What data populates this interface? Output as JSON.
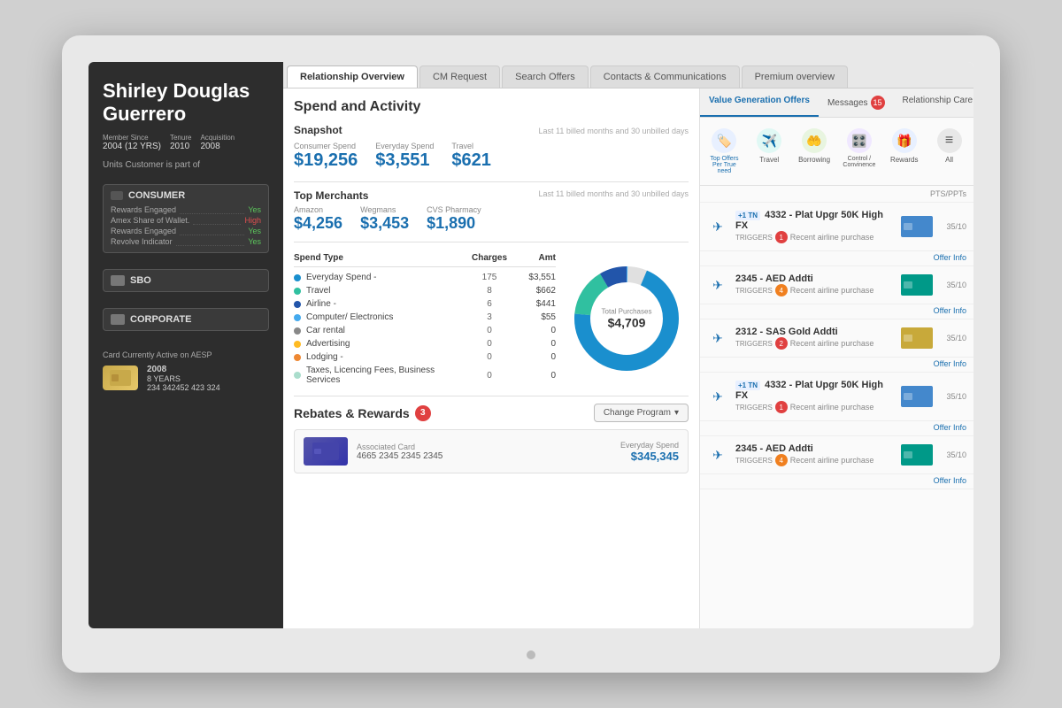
{
  "laptop": {
    "screen_bg": "#f0f0f0"
  },
  "customer": {
    "name": "Shirley Douglas Guerrero",
    "member_since_label": "Member Since",
    "member_since": "2004 (12 YRS)",
    "tenure_label": "Tenure",
    "tenure": "2010",
    "acquisition_label": "Acquisition",
    "acquisition": "2008",
    "units_label": "Units Customer is part of"
  },
  "consumer_unit": {
    "title": "CONSUMER",
    "rows": [
      {
        "label": "Rewards Engaged",
        "value": "Yes",
        "type": "yes"
      },
      {
        "label": "Amex Share of Wallet.",
        "value": "High",
        "type": "high"
      },
      {
        "label": "Rewards Engaged",
        "value": "Yes",
        "type": "yes"
      },
      {
        "label": "Revolve Indicator",
        "value": "Yes",
        "type": "yes"
      }
    ]
  },
  "sbo_unit": {
    "title": "SBO"
  },
  "corporate_unit": {
    "title": "CORPORATE"
  },
  "aesp": {
    "label": "Card Currently Active on AESP",
    "year": "2008",
    "tenure": "8 YEARS",
    "number": "234 342452 423 324"
  },
  "tabs": [
    {
      "label": "Relationship Overview",
      "active": true
    },
    {
      "label": "CM Request",
      "active": false
    },
    {
      "label": "Search Offers",
      "active": false
    },
    {
      "label": "Contacts & Communications",
      "active": false
    },
    {
      "label": "Premium overview",
      "active": false
    }
  ],
  "spend": {
    "section_title": "Spend and Activity",
    "snapshot_label": "Snapshot",
    "snapshot_period": "Last 11 billed months and 30 unbilled days",
    "consumer_spend_label": "Consumer Spend",
    "consumer_spend": "$19,256",
    "everyday_spend_label": "Everyday Spend",
    "everyday_spend": "$3,551",
    "travel_label": "Travel",
    "travel": "$621",
    "merchants_label": "Top Merchants",
    "merchants_period": "Last 11 billed months and 30 unbilled days",
    "amazon_label": "Amazon",
    "amazon": "$4,256",
    "wegmans_label": "Wegmans",
    "wegmans": "$3,453",
    "cvs_label": "CVS Pharmacy",
    "cvs": "$1,890",
    "spend_type_header": "Spend Type",
    "charges_header": "Charges",
    "amt_header": "Amt",
    "spend_rows": [
      {
        "color": "#1a8fce",
        "name": "Everyday Spend -",
        "charges": "175",
        "amt": "$3,551"
      },
      {
        "color": "#30c0a0",
        "name": "Travel",
        "charges": "8",
        "amt": "$662"
      },
      {
        "color": "#2255aa",
        "name": "Airline -",
        "charges": "6",
        "amt": "$441"
      },
      {
        "color": "#44aaee",
        "name": "Computer/ Electronics",
        "charges": "3",
        "amt": "$55"
      },
      {
        "color": "#888888",
        "name": "Car rental",
        "charges": "0",
        "amt": "0"
      },
      {
        "color": "#ffbb22",
        "name": "Advertising",
        "charges": "0",
        "amt": "0"
      },
      {
        "color": "#ee8833",
        "name": "Lodging -",
        "charges": "0",
        "amt": "0"
      },
      {
        "color": "#aaddcc",
        "name": "Taxes, Licencing Fees, Business Services",
        "charges": "0",
        "amt": "0"
      }
    ],
    "donut_label": "Total Purchases",
    "donut_value": "$4,709"
  },
  "rebates": {
    "title": "Rebates & Rewards",
    "count": "3",
    "change_program": "Change Program",
    "card_type": "Associated Card",
    "card_number": "4665 2345 2345 2345",
    "spend_label": "Everyday Spend",
    "spend_value": "$345,345"
  },
  "right_panel": {
    "tabs": [
      {
        "label": "Value Generation Offers",
        "active": true
      },
      {
        "label": "Messages",
        "active": false,
        "badge": "15"
      },
      {
        "label": "Relationship Care History",
        "active": false
      }
    ],
    "categories": [
      {
        "label": "Top Offers\nPer True need",
        "icon": "🏷️",
        "color": "blue",
        "active": true
      },
      {
        "label": "Travel",
        "icon": "✈️",
        "color": "teal"
      },
      {
        "label": "Borrowing",
        "icon": "🤲",
        "color": "green"
      },
      {
        "label": "Control /\nConvinence",
        "icon": "🎛️",
        "color": "purple"
      },
      {
        "label": "Rewards",
        "icon": "🎁",
        "color": "blue"
      },
      {
        "label": "All",
        "icon": "≡",
        "color": "gray"
      }
    ],
    "pts_header": "PTS/PPTs",
    "offers": [
      {
        "title": "4332 - Plat Upgr 50K High FX",
        "plus": "+1 TN",
        "trigger_num": "1",
        "trigger_color": "red",
        "trigger_text": "Recent airline purchase",
        "pts": "35/10",
        "thumb_color": "blue"
      },
      {
        "title": "2345 - AED Addti",
        "plus": null,
        "trigger_num": "4",
        "trigger_color": "orange",
        "trigger_text": "Recent airline purchase",
        "pts": "35/10",
        "thumb_color": "teal"
      },
      {
        "title": "2312 - SAS Gold Addti",
        "plus": null,
        "trigger_num": "2",
        "trigger_color": "red",
        "trigger_text": "Recent airline purchase",
        "pts": "35/10",
        "thumb_color": "gold"
      },
      {
        "title": "4332 - Plat Upgr 50K High FX",
        "plus": "+1 TN",
        "trigger_num": "1",
        "trigger_color": "red",
        "trigger_text": "Recent airline purchase",
        "pts": "35/10",
        "thumb_color": "blue"
      },
      {
        "title": "2345 - AED Addti",
        "plus": null,
        "trigger_num": "4",
        "trigger_color": "orange",
        "trigger_text": "Recent airline purchase",
        "pts": "35/10",
        "thumb_color": "teal"
      }
    ],
    "offer_info_label": "Offer Info"
  }
}
